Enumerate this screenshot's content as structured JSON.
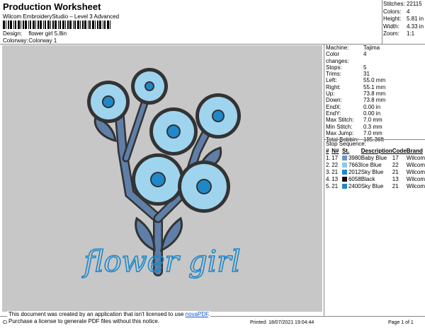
{
  "header": {
    "title": "Production Worksheet",
    "subtitle": "Wilcom EmbroideryStudio – Level 3 Advanced",
    "design_label": "Design:",
    "design_value": "flower girl 5.8in",
    "colorway_label": "Colorway:",
    "colorway_value": "Colorway 1"
  },
  "stats": [
    {
      "label": "Stitches:",
      "value": "22115"
    },
    {
      "label": "Colors:",
      "value": "4"
    },
    {
      "label": "Height:",
      "value": "5.81 in"
    },
    {
      "label": "Width:",
      "value": "4.33 in"
    },
    {
      "label": "Zoom:",
      "value": "1:1"
    }
  ],
  "details": [
    {
      "label": "Machine:",
      "value": "Tajima"
    },
    {
      "label": "Color changes:",
      "value": "4"
    },
    {
      "label": "Stops:",
      "value": "5"
    },
    {
      "label": "Trims:",
      "value": "31"
    },
    {
      "label": "Left:",
      "value": "55.0 mm"
    },
    {
      "label": "Right:",
      "value": "55.1 mm"
    },
    {
      "label": "Up:",
      "value": "73.8 mm"
    },
    {
      "label": "Down:",
      "value": "73.8 mm"
    },
    {
      "label": "EndX:",
      "value": "0.00 in"
    },
    {
      "label": "EndY:",
      "value": "0.00 in"
    },
    {
      "label": "Max Stitch:",
      "value": "7.0 mm"
    },
    {
      "label": "Min Stitch:",
      "value": "0.3 mm"
    },
    {
      "label": "Max Jump:",
      "value": "7.0 mm"
    },
    {
      "label": "Total Bobbin:",
      "value": "185.36ft"
    }
  ],
  "stop_sequence": {
    "title": "Stop Sequence:",
    "columns": [
      "#",
      "N#",
      "St.",
      "Description",
      "Code",
      "Brand"
    ],
    "rows": [
      {
        "num": "1.",
        "n": "17",
        "color": "#6f95c9",
        "st": "3980",
        "desc": "Baby Blue",
        "code": "17",
        "brand": "Wilcom"
      },
      {
        "num": "2.",
        "n": "22",
        "color": "#8fc8e8",
        "st": "7663",
        "desc": "Ice Blue",
        "code": "22",
        "brand": "Wilcom"
      },
      {
        "num": "3.",
        "n": "21",
        "color": "#1f88c8",
        "st": "2012",
        "desc": "Sky Blue",
        "code": "21",
        "brand": "Wilcom"
      },
      {
        "num": "4.",
        "n": "13",
        "color": "#111111",
        "st": "6058",
        "desc": "Black",
        "code": "13",
        "brand": "Wilcom"
      },
      {
        "num": "5.",
        "n": "21",
        "color": "#1f88c8",
        "st": "2400",
        "desc": "Sky Blue",
        "code": "21",
        "brand": "Wilcom"
      }
    ]
  },
  "design_text": "flower girl",
  "footer": {
    "cr": "Cr",
    "notice_line1": "This document was created by an application that isn't licensed to use ",
    "notice_link": "novaPDF",
    "notice_line1_end": ".",
    "notice_line2": "Purchase a license to generate PDF files without this notice.",
    "printed": "Printed: 18/07/2021 19:04:44",
    "page": "Page 1 of 1"
  }
}
